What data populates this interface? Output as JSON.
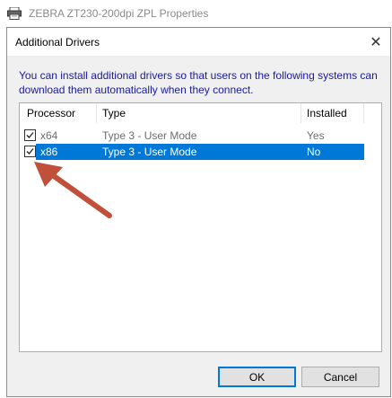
{
  "parent_window": {
    "title": "ZEBRA ZT230-200dpi ZPL Properties",
    "icon": "printer-icon"
  },
  "dialog": {
    "title": "Additional Drivers",
    "close_glyph": "✕",
    "description": "You can install additional drivers so that users on the following systems can download them automatically when they connect."
  },
  "table": {
    "columns": [
      "Processor",
      "Type",
      "Installed"
    ],
    "rows": [
      {
        "processor": "x64",
        "type": "Type 3 - User Mode",
        "installed": "Yes",
        "checked": true,
        "selected": false
      },
      {
        "processor": "x86",
        "type": "Type 3 - User Mode",
        "installed": "No",
        "checked": true,
        "selected": true
      }
    ]
  },
  "buttons": {
    "ok": "OK",
    "cancel": "Cancel"
  },
  "colors": {
    "selection": "#0078d7",
    "annotation_arrow": "#c0503a",
    "description_text": "#1a1a9a"
  }
}
